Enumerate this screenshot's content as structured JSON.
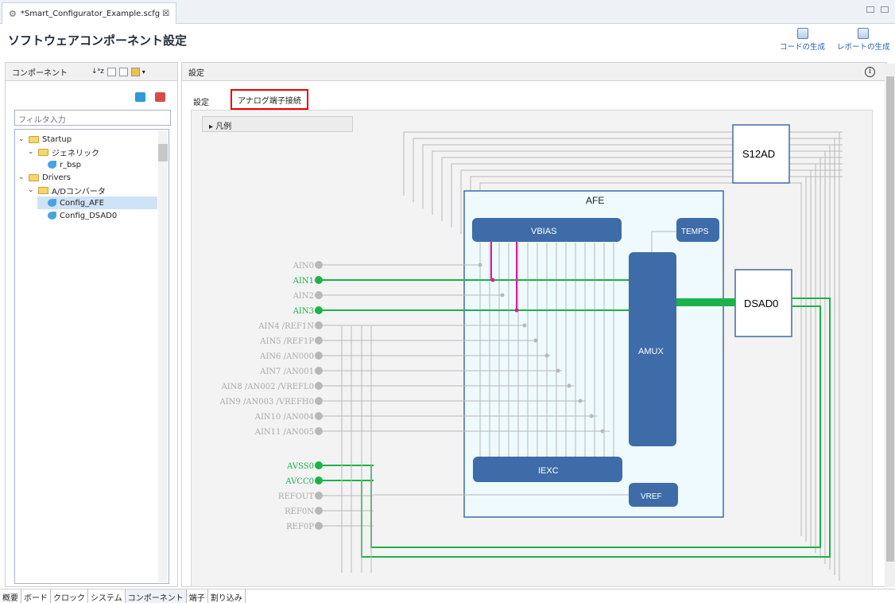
{
  "editor": {
    "tab_title": "*Smart_Configurator_Example.scfg ☒"
  },
  "header": {
    "title": "ソフトウェアコンポーネント設定",
    "gen_code": "コードの生成",
    "gen_report": "レポートの生成"
  },
  "left": {
    "title": "コンポーネント",
    "filter_placeholder": "フィルタ入力",
    "tree": [
      {
        "label": "Startup",
        "kind": "folder",
        "depth": 0,
        "expanded": true
      },
      {
        "label": "ジェネリック",
        "kind": "folder",
        "depth": 1,
        "expanded": true
      },
      {
        "label": "r_bsp",
        "kind": "component",
        "depth": 2
      },
      {
        "label": "Drivers",
        "kind": "folder",
        "depth": 0,
        "expanded": true
      },
      {
        "label": "A/Dコンバータ",
        "kind": "folder",
        "depth": 1,
        "expanded": true
      },
      {
        "label": "Config_AFE",
        "kind": "component",
        "depth": 2,
        "selected": true
      },
      {
        "label": "Config_DSAD0",
        "kind": "component",
        "depth": 2
      }
    ]
  },
  "right": {
    "title": "設定",
    "tab_setting": "設定",
    "tab_analog": "アナログ端子接続",
    "legend": "▸ 凡例",
    "info": "i"
  },
  "diagram": {
    "blocks": {
      "s12ad": "S12AD",
      "afe": "AFE",
      "vbias": "VBIAS",
      "temps": "TEMPS",
      "amux": "AMUX",
      "iexc": "IEXC",
      "vref": "VREF",
      "dsad0": "DSAD0"
    },
    "pins": [
      {
        "label": "AIN0",
        "active": false
      },
      {
        "label": "AIN1",
        "active": true
      },
      {
        "label": "AIN2",
        "active": false
      },
      {
        "label": "AIN3",
        "active": true
      },
      {
        "label": "AIN4 /REF1N",
        "active": false
      },
      {
        "label": "AIN5 /REF1P",
        "active": false
      },
      {
        "label": "AIN6 /AN000",
        "active": false
      },
      {
        "label": "AIN7 /AN001",
        "active": false
      },
      {
        "label": "AIN8 /AN002 /VREFL0",
        "active": false
      },
      {
        "label": "AIN9 /AN003 /VREFH0",
        "active": false
      },
      {
        "label": "AIN10 /AN004",
        "active": false
      },
      {
        "label": "AIN11 /AN005",
        "active": false
      }
    ],
    "ref_pins": [
      {
        "label": "AVSS0",
        "active": true
      },
      {
        "label": "AVCC0",
        "active": true
      },
      {
        "label": "REFOUT",
        "active": false
      },
      {
        "label": "REF0N",
        "active": false
      },
      {
        "label": "REF0P",
        "active": false
      }
    ],
    "colors": {
      "green": "#1bb24a",
      "pink": "#e0199a",
      "gray": "#b8b8b8",
      "block": "#3d6ca8",
      "afe_bg": "#eefafd"
    }
  },
  "bottom_tabs": [
    "概要",
    "ボード",
    "クロック",
    "システム",
    "コンポーネント",
    "端子",
    "割り込み"
  ]
}
